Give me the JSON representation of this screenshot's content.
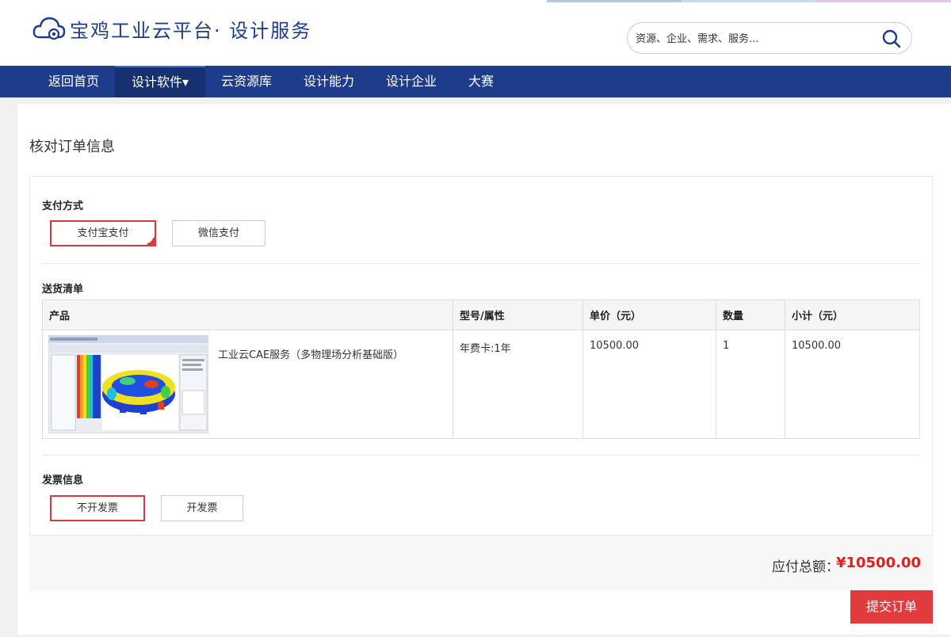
{
  "header": {
    "logo_text": "宝鸡工业云平台· 设计服务",
    "search_placeholder": "资源、企业、需求、服务...",
    "strip_colors": [
      "#b8c6de",
      "#c8dcf0",
      "#e0c8e8"
    ]
  },
  "nav": {
    "items": [
      {
        "label": "返回首页",
        "active": false
      },
      {
        "label": "设计软件▾",
        "active": true
      },
      {
        "label": "云资源库",
        "active": false
      },
      {
        "label": "设计能力",
        "active": false
      },
      {
        "label": "设计企业",
        "active": false
      },
      {
        "label": "大赛",
        "active": false
      }
    ]
  },
  "page": {
    "title": "核对订单信息"
  },
  "payment": {
    "label": "支付方式",
    "options": [
      {
        "label": "支付宝支付",
        "selected": true
      },
      {
        "label": "微信支付",
        "selected": false
      }
    ]
  },
  "delivery": {
    "label": "送货清单",
    "columns": [
      "产品",
      "型号/属性",
      "单价（元）",
      "数量",
      "小计（元）"
    ],
    "rows": [
      {
        "product": "工业云CAE服务（多物理场分析基础版）",
        "model": "年费卡:1年",
        "price": "10500.00",
        "qty": "1",
        "subtotal": "10500.00"
      }
    ]
  },
  "invoice": {
    "label": "发票信息",
    "options": [
      {
        "label": "不开发票",
        "selected": true
      },
      {
        "label": "开发票",
        "selected": false
      }
    ]
  },
  "summary": {
    "total_label": "应付总额：",
    "total_value": "¥10500.00"
  },
  "actions": {
    "submit_label": "提交订单"
  },
  "colors": {
    "nav_bg": "#1e3c8c",
    "accent_red": "#d9383c",
    "submit_bg": "#e23b3e",
    "total_red": "#e02020"
  }
}
